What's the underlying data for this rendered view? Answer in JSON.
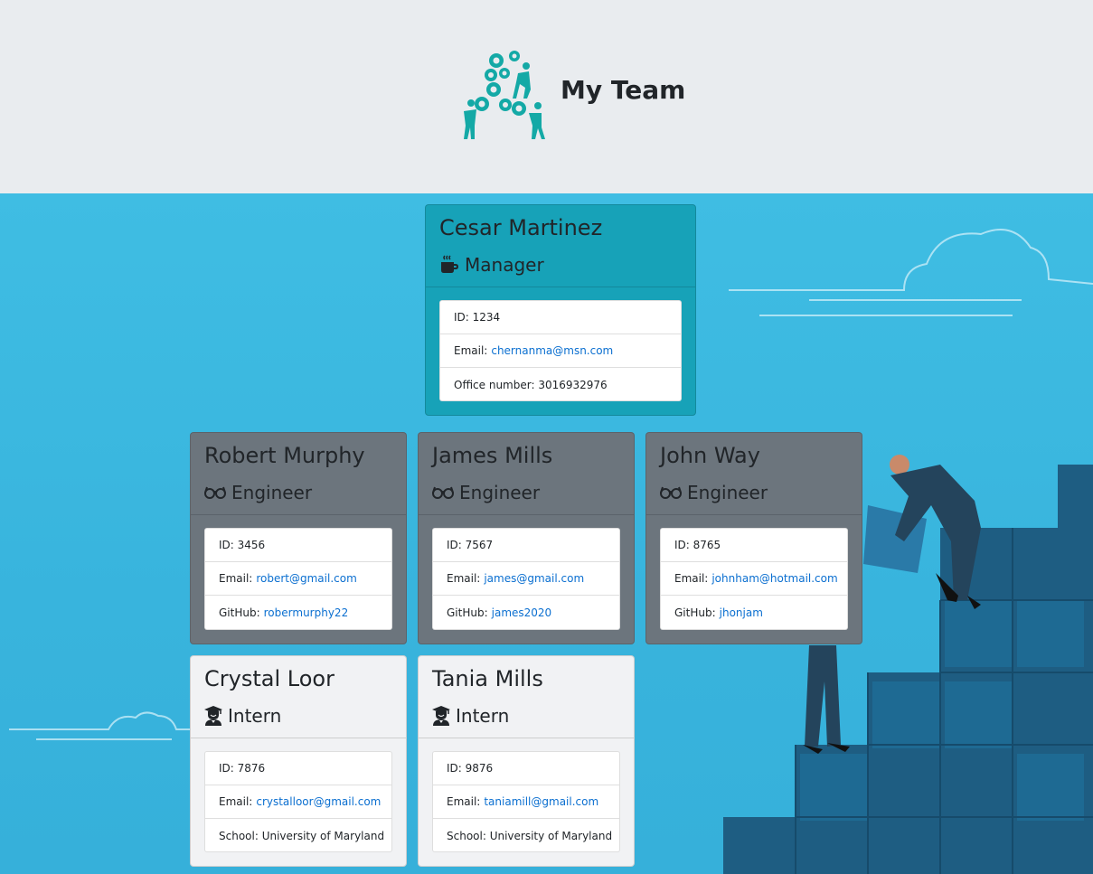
{
  "header": {
    "title": "My Team"
  },
  "colors": {
    "manager": "#17a2b8",
    "engineer": "#6c757d",
    "intern": "#f1f2f4",
    "link": "#0b6fd0",
    "logo": "#14a9a6"
  },
  "cards": {
    "manager": {
      "name": "Cesar Martinez",
      "role": "Manager",
      "icon": "coffee-icon",
      "id_label": "ID: 1234",
      "email_label": "Email:",
      "email": "chernanma@msn.com",
      "extra_label": "Office number: 3016932976"
    },
    "engineer1": {
      "name": "Robert Murphy",
      "role": "Engineer",
      "icon": "glasses-icon",
      "id_label": "ID: 3456",
      "email_label": "Email:",
      "email": "robert@gmail.com",
      "extra_label": "GitHub:",
      "extra_value": "robermurphy22"
    },
    "engineer2": {
      "name": "James Mills",
      "role": "Engineer",
      "icon": "glasses-icon",
      "id_label": "ID: 7567",
      "email_label": "Email:",
      "email": "james@gmail.com",
      "extra_label": "GitHub:",
      "extra_value": "james2020"
    },
    "engineer3": {
      "name": "John Way",
      "role": "Engineer",
      "icon": "glasses-icon",
      "id_label": "ID: 8765",
      "email_label": "Email:",
      "email": "johnham@hotmail.com",
      "extra_label": "GitHub:",
      "extra_value": "jhonjam"
    },
    "intern1": {
      "name": "Crystal Loor",
      "role": "Intern",
      "icon": "graduate-icon",
      "id_label": "ID: 7876",
      "email_label": "Email:",
      "email": "crystalloor@gmail.com",
      "extra_label": "School: University of Maryland"
    },
    "intern2": {
      "name": "Tania Mills",
      "role": "Intern",
      "icon": "graduate-icon",
      "id_label": "ID: 9876",
      "email_label": "Email:",
      "email": "taniamill@gmail.com",
      "extra_label": "School: University of Maryland"
    }
  }
}
